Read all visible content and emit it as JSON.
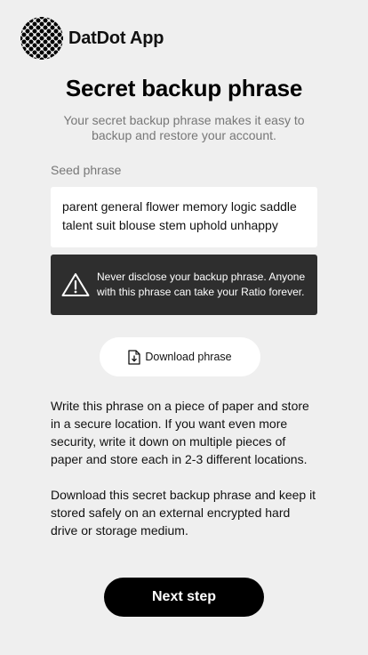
{
  "app": {
    "name": "DatDot App",
    "logo_icon": "dotted-circle-logo-icon"
  },
  "header": {
    "title": "Secret backup phrase",
    "subtitle": "Your secret backup phrase makes it easy to backup and restore your account."
  },
  "seed": {
    "label": "Seed phrase",
    "phrase": "parent general flower memory logic saddle talent suit blouse stem uphold unhappy"
  },
  "warning": {
    "icon": "warning-triangle-icon",
    "text": "Never disclose your backup phrase. Anyone with this phrase can take your Ratio forever."
  },
  "download": {
    "label": "Download phrase",
    "icon": "download-file-icon"
  },
  "instructions": {
    "paragraph_1": "Write this phrase on a piece of paper and store in a secure location. If you want even more security, write it down on multiple pieces of paper and store each in 2-3 different locations.",
    "paragraph_2": "Download this secret backup phrase and keep it stored safely on an external encrypted hard drive or storage medium."
  },
  "actions": {
    "next_label": "Next step"
  },
  "colors": {
    "background": "#efefef",
    "primary": "#000000",
    "warning_bg": "#2e2e2e",
    "muted_text": "#777777"
  }
}
